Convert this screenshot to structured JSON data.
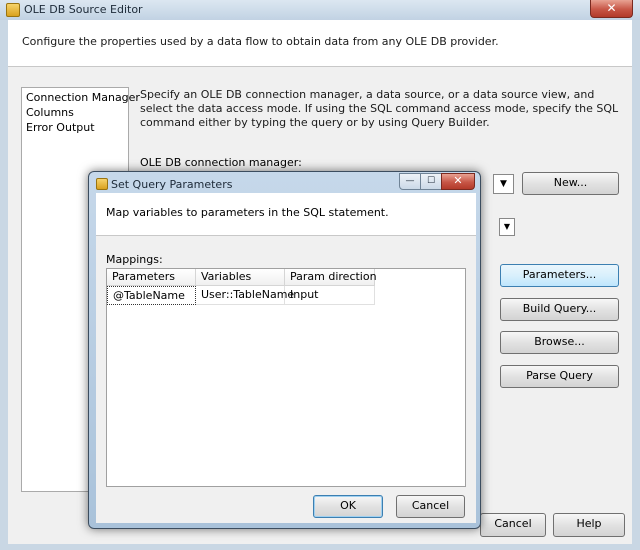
{
  "outer": {
    "title": "OLE DB Source Editor",
    "close_glyph": "✕",
    "description": "Configure the properties used by a data flow to obtain data from any OLE DB provider.",
    "nav": [
      "Connection Manager",
      "Columns",
      "Error Output"
    ],
    "instructions": "Specify an OLE DB connection manager, a data source, or a data source view, and select the data access mode. If using the SQL command access mode, specify the SQL command either by typing the query or by using Query Builder.",
    "connection_manager_label": "OLE DB connection manager:",
    "dropdown_glyph": "▼",
    "buttons": {
      "new": "New...",
      "parameters": "Parameters...",
      "build_query": "Build Query...",
      "browse": "Browse...",
      "parse_query": "Parse Query",
      "cancel": "Cancel",
      "help": "Help"
    }
  },
  "dialog": {
    "title": "Set Query Parameters",
    "caption_buttons": {
      "minimize": "—",
      "maximize": "☐",
      "close": "✕"
    },
    "description": "Map variables to parameters in the SQL statement.",
    "mappings_label": "Mappings:",
    "columns": [
      "Parameters",
      "Variables",
      "Param direction"
    ],
    "rows": [
      {
        "parameter": "@TableName",
        "variable": "User::TableName",
        "direction": "Input"
      }
    ],
    "ok_label": "OK",
    "cancel_label": "Cancel"
  },
  "colors": {
    "title_bar": "#c1d2e3",
    "close_button": "#c75646",
    "dialog_frame": "#a9c2da",
    "default_button_border": "#3c7fb1"
  },
  "icons": [
    "app-icon",
    "close-icon",
    "minimize-icon",
    "maximize-icon",
    "dropdown-arrow-icon"
  ]
}
